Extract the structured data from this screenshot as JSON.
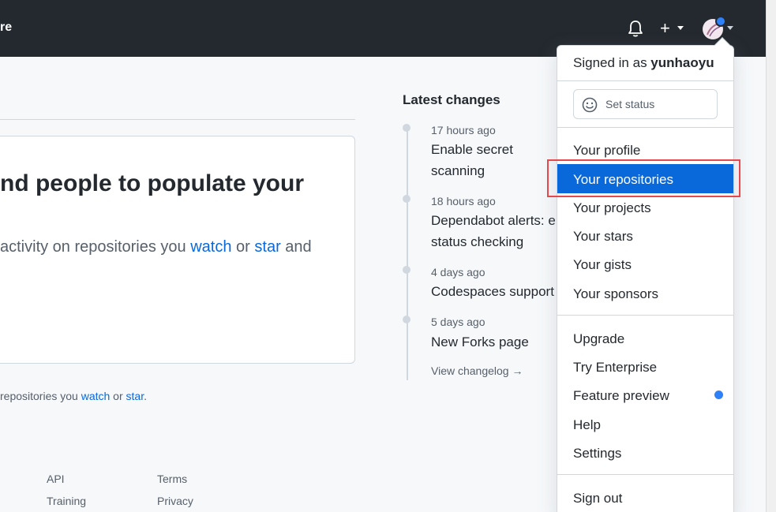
{
  "header": {
    "cropped_title": "re",
    "new_symbol": "+"
  },
  "feed": {
    "title": "nd people to populate your",
    "text_before": "activity on repositories you ",
    "watch": "watch",
    "or": " or ",
    "star": "star",
    "text_after": " and",
    "sub_before": "repositories you ",
    "sub_watch": "watch",
    "sub_or": " or ",
    "sub_star": "star",
    "sub_after": "."
  },
  "footer": {
    "links": [
      "API",
      "Training",
      "Terms",
      "Privacy"
    ]
  },
  "latest_changes": {
    "title": "Latest changes",
    "items": [
      {
        "time": "17 hours ago",
        "text": "Enable secret scanning repositories"
      },
      {
        "time": "18 hours ago",
        "text": "Dependabot alerts: e status checking"
      },
      {
        "time": "4 days ago",
        "text": "Codespaces support"
      },
      {
        "time": "5 days ago",
        "text": "New Forks page view"
      }
    ],
    "view_changelog": "View changelog →"
  },
  "dropdown": {
    "signed_in_prefix": "Signed in as ",
    "username": "yunhaoyu",
    "set_status": "Set status",
    "items": [
      "Your profile",
      "Your repositories",
      "Your projects",
      "Your stars",
      "Your gists",
      "Your sponsors",
      "Upgrade",
      "Try Enterprise",
      "Feature preview",
      "Help",
      "Settings",
      "Sign out"
    ],
    "highlighted": "Your repositories"
  },
  "colors": {
    "header_bg": "#24292f",
    "accent": "#0969da",
    "annotation": "#e5484d"
  }
}
